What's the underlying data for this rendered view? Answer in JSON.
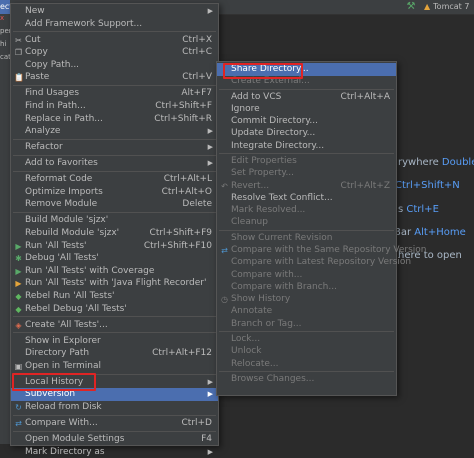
{
  "topbar": {
    "tab_partial": "ect",
    "run_config": "Tomcat 7"
  },
  "left_tabs": [
    "x",
    "peri",
    "hi",
    "catc"
  ],
  "editor_hints": [
    {
      "text": "rywhere ",
      "key": "Double"
    },
    {
      "text": "",
      "key": "Ctrl+Shift+N"
    },
    {
      "text": "s ",
      "key": "Ctrl+E"
    },
    {
      "text": " Bar ",
      "key": "Alt+Home"
    },
    {
      "text": "here to open",
      "key": ""
    }
  ],
  "main_menu": [
    {
      "label": "New",
      "shortcut": "",
      "submenu": true
    },
    {
      "label": "Add Framework Support...",
      "shortcut": ""
    },
    {
      "sep": true
    },
    {
      "label": "Cut",
      "shortcut": "Ctrl+X",
      "icon": "cut-icon"
    },
    {
      "label": "Copy",
      "shortcut": "Ctrl+C",
      "icon": "copy-icon"
    },
    {
      "label": "Copy Path...",
      "shortcut": ""
    },
    {
      "label": "Paste",
      "shortcut": "Ctrl+V",
      "icon": "paste-icon"
    },
    {
      "sep": true
    },
    {
      "label": "Find Usages",
      "shortcut": "Alt+F7"
    },
    {
      "label": "Find in Path...",
      "shortcut": "Ctrl+Shift+F"
    },
    {
      "label": "Replace in Path...",
      "shortcut": "Ctrl+Shift+R"
    },
    {
      "label": "Analyze",
      "shortcut": "",
      "submenu": true
    },
    {
      "sep": true
    },
    {
      "label": "Refactor",
      "shortcut": "",
      "submenu": true
    },
    {
      "sep": true
    },
    {
      "label": "Add to Favorites",
      "shortcut": "",
      "submenu": true
    },
    {
      "sep": true
    },
    {
      "label": "Reformat Code",
      "shortcut": "Ctrl+Alt+L"
    },
    {
      "label": "Optimize Imports",
      "shortcut": "Ctrl+Alt+O"
    },
    {
      "label": "Remove Module",
      "shortcut": "Delete"
    },
    {
      "sep": true
    },
    {
      "label": "Build Module 'sjzx'",
      "shortcut": ""
    },
    {
      "label": "Rebuild Module 'sjzx'",
      "shortcut": "Ctrl+Shift+F9"
    },
    {
      "label": "Run 'All Tests'",
      "shortcut": "Ctrl+Shift+F10",
      "icon": "run-icon"
    },
    {
      "label": "Debug 'All Tests'",
      "shortcut": "",
      "icon": "debug-icon"
    },
    {
      "label": "Run 'All Tests' with Coverage",
      "shortcut": "",
      "icon": "coverage-icon"
    },
    {
      "label": "Run 'All Tests' with 'Java Flight Recorder'",
      "shortcut": "",
      "icon": "flight-recorder-icon"
    },
    {
      "label": "Rebel Run 'All Tests'",
      "shortcut": "",
      "icon": "rebel-run-icon"
    },
    {
      "label": "Rebel Debug 'All Tests'",
      "shortcut": "",
      "icon": "rebel-debug-icon"
    },
    {
      "sep": true
    },
    {
      "label": "Create 'All Tests'...",
      "shortcut": "",
      "icon": "create-test-icon"
    },
    {
      "sep": true
    },
    {
      "label": "Show in Explorer",
      "shortcut": ""
    },
    {
      "label": "Directory Path",
      "shortcut": "Ctrl+Alt+F12"
    },
    {
      "label": "Open in Terminal",
      "shortcut": "",
      "icon": "terminal-icon"
    },
    {
      "sep": true
    },
    {
      "label": "Local History",
      "shortcut": "",
      "submenu": true
    },
    {
      "label": "Subversion",
      "shortcut": "",
      "submenu": true,
      "highlighted": true
    },
    {
      "label": "Reload from Disk",
      "shortcut": "",
      "icon": "reload-icon"
    },
    {
      "sep": true
    },
    {
      "label": "Compare With...",
      "shortcut": "Ctrl+D",
      "icon": "compare-icon"
    },
    {
      "sep": true
    },
    {
      "label": "Open Module Settings",
      "shortcut": "F4"
    },
    {
      "label": "Mark Directory as",
      "shortcut": "",
      "submenu": true
    }
  ],
  "sub_menu": [
    {
      "label": "Share Directory...",
      "shortcut": "",
      "highlighted": true
    },
    {
      "label": "Create External...",
      "shortcut": "",
      "disabled": true
    },
    {
      "sep": true
    },
    {
      "label": "Add to VCS",
      "shortcut": "Ctrl+Alt+A"
    },
    {
      "label": "Ignore",
      "shortcut": ""
    },
    {
      "label": "Commit Directory...",
      "shortcut": ""
    },
    {
      "label": "Update Directory...",
      "shortcut": ""
    },
    {
      "label": "Integrate Directory...",
      "shortcut": ""
    },
    {
      "sep": true
    },
    {
      "label": "Edit Properties",
      "shortcut": "",
      "disabled": true
    },
    {
      "label": "Set Property...",
      "shortcut": "",
      "disabled": true
    },
    {
      "label": "Revert...",
      "shortcut": "Ctrl+Alt+Z",
      "disabled": true,
      "icon": "revert-icon"
    },
    {
      "label": "Resolve Text Conflict...",
      "shortcut": ""
    },
    {
      "label": "Mark Resolved...",
      "shortcut": "",
      "disabled": true
    },
    {
      "label": "Cleanup",
      "shortcut": "",
      "disabled": true
    },
    {
      "sep": true
    },
    {
      "label": "Show Current Revision",
      "shortcut": "",
      "disabled": true
    },
    {
      "label": "Compare with the Same Repository Version",
      "shortcut": "",
      "disabled": true,
      "icon": "compare-icon"
    },
    {
      "label": "Compare with Latest Repository Version",
      "shortcut": "",
      "disabled": true
    },
    {
      "label": "Compare with...",
      "shortcut": "",
      "disabled": true
    },
    {
      "label": "Compare with Branch...",
      "shortcut": "",
      "disabled": true
    },
    {
      "label": "Show History",
      "shortcut": "",
      "disabled": true,
      "icon": "history-icon"
    },
    {
      "label": "Annotate",
      "shortcut": "",
      "disabled": true
    },
    {
      "label": "Branch or Tag...",
      "shortcut": "",
      "disabled": true
    },
    {
      "sep": true
    },
    {
      "label": "Lock...",
      "shortcut": "",
      "disabled": true
    },
    {
      "label": "Unlock",
      "shortcut": "",
      "disabled": true
    },
    {
      "label": "Relocate...",
      "shortcut": "",
      "disabled": true
    },
    {
      "sep": true
    },
    {
      "label": "Browse Changes...",
      "shortcut": "",
      "disabled": true
    }
  ],
  "colors": {
    "accent": "#4b6eaf",
    "menu_bg": "#3c3f41",
    "editor_bg": "#2b2b2b",
    "highlight_box": "#e02424",
    "key": "#589df6"
  }
}
